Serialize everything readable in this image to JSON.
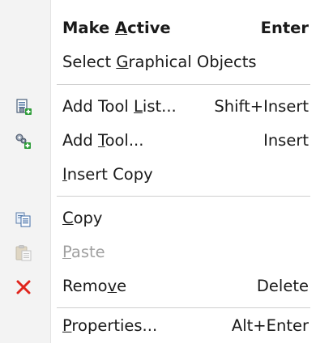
{
  "menu": {
    "items": [
      {
        "pre": "Make ",
        "ul": "A",
        "post": "ctive",
        "shortcut": "Enter",
        "bold": true,
        "disabled": false,
        "icon": ""
      },
      {
        "pre": "Select ",
        "ul": "G",
        "post": "raphical Objects",
        "shortcut": "",
        "bold": false,
        "disabled": false,
        "icon": ""
      },
      {
        "pre": "Add Tool ",
        "ul": "L",
        "post": "ist...",
        "shortcut": "Shift+Insert",
        "bold": false,
        "disabled": false,
        "icon": "add-tool-list-icon"
      },
      {
        "pre": "Add ",
        "ul": "T",
        "post": "ool...",
        "shortcut": "Insert",
        "bold": false,
        "disabled": false,
        "icon": "add-tool-icon"
      },
      {
        "pre": "",
        "ul": "I",
        "post": "nsert Copy",
        "shortcut": "",
        "bold": false,
        "disabled": false,
        "icon": ""
      },
      {
        "pre": "",
        "ul": "C",
        "post": "opy",
        "shortcut": "",
        "bold": false,
        "disabled": false,
        "icon": "copy-icon"
      },
      {
        "pre": "",
        "ul": "P",
        "post": "aste",
        "shortcut": "",
        "bold": false,
        "disabled": true,
        "icon": "paste-icon"
      },
      {
        "pre": "Remo",
        "ul": "v",
        "post": "e",
        "shortcut": "Delete",
        "bold": false,
        "disabled": false,
        "icon": "remove-icon"
      },
      {
        "pre": "",
        "ul": "P",
        "post": "roperties...",
        "shortcut": "Alt+Enter",
        "bold": false,
        "disabled": false,
        "icon": ""
      }
    ]
  },
  "colors": {
    "gutter": "#f3f3f3",
    "text": "#1a1a1a",
    "disabled_text": "#a0a0a0",
    "remove_icon": "#e0241c",
    "separator": "#cfcfcf"
  }
}
